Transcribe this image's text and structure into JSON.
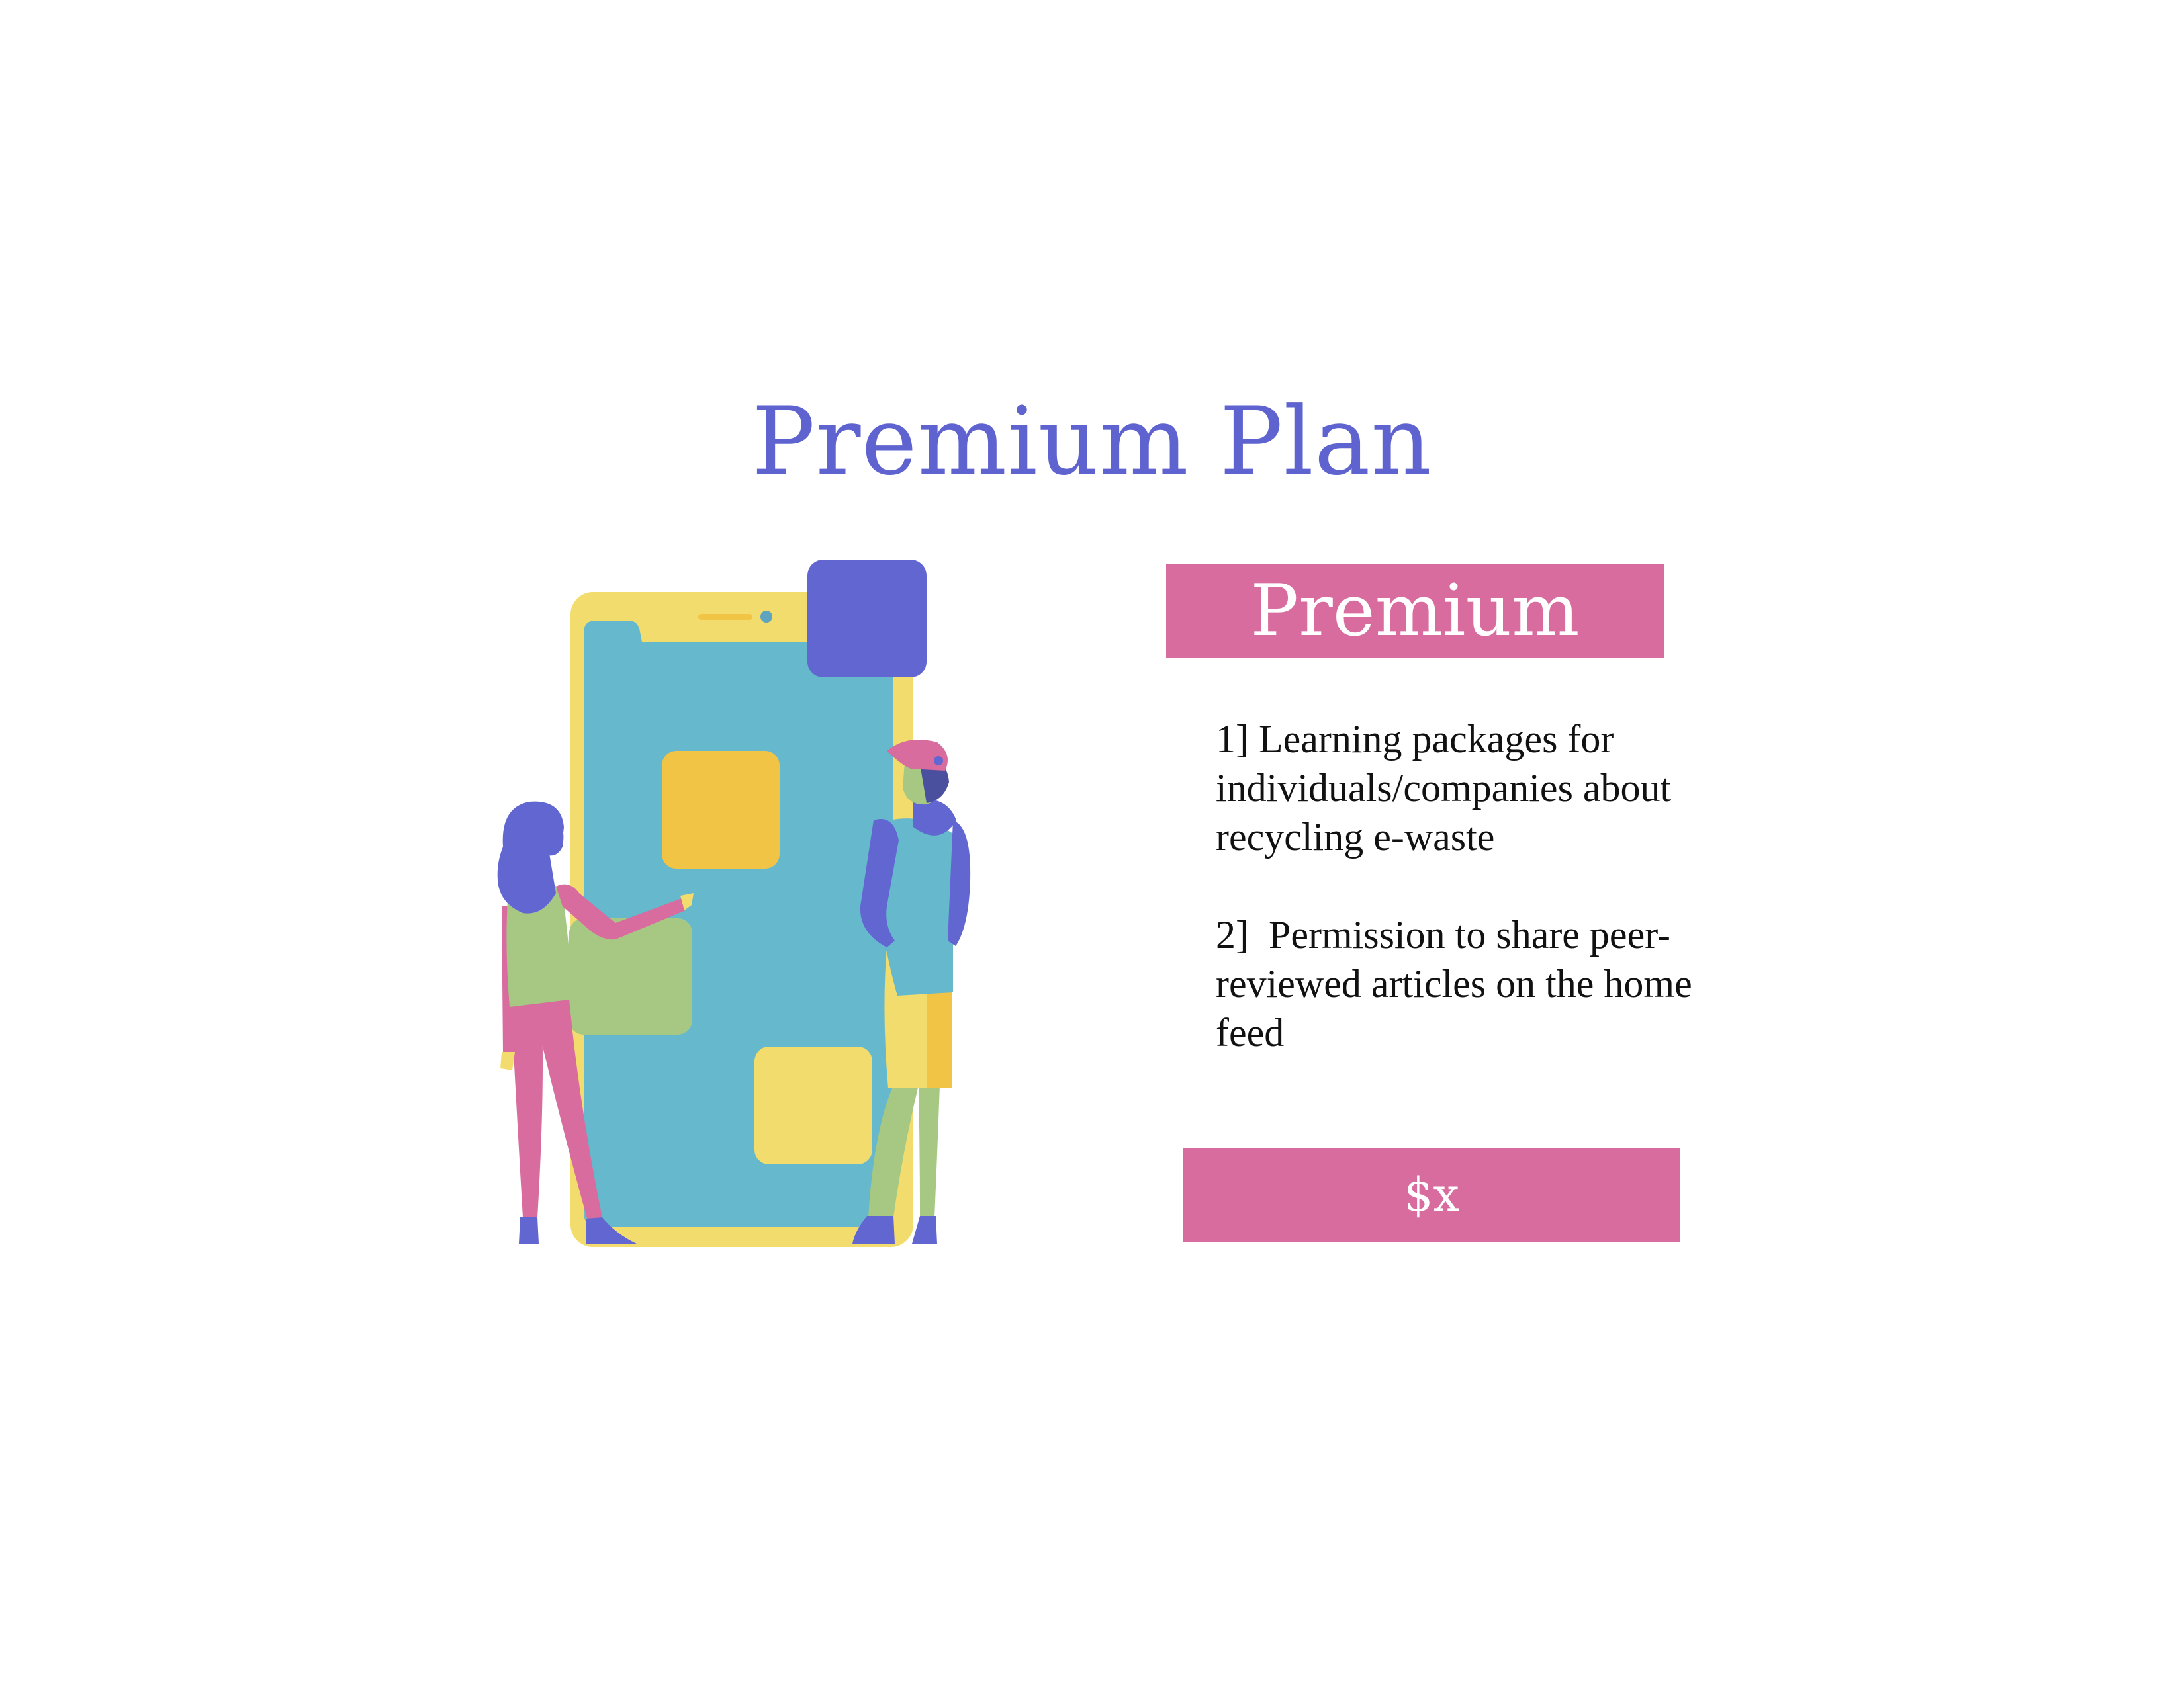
{
  "page": {
    "title": "Premium Plan"
  },
  "plan": {
    "name": "Premium",
    "features": [
      "1] Learning packages for individuals/companies about recycling e-waste",
      "2]  Permission to share peer-reviewed articles on the home feed"
    ],
    "price_label": "$x"
  },
  "colors": {
    "title": "#5e63cf",
    "accent_pink": "#d96c9e",
    "phone_frame": "#f2dc6e",
    "phone_screen": "#66b8cc",
    "indigo": "#6166d1",
    "amber": "#f2c446",
    "green": "#a6c882"
  },
  "illustration": {
    "icon": "people-with-smartphone-illustration"
  }
}
